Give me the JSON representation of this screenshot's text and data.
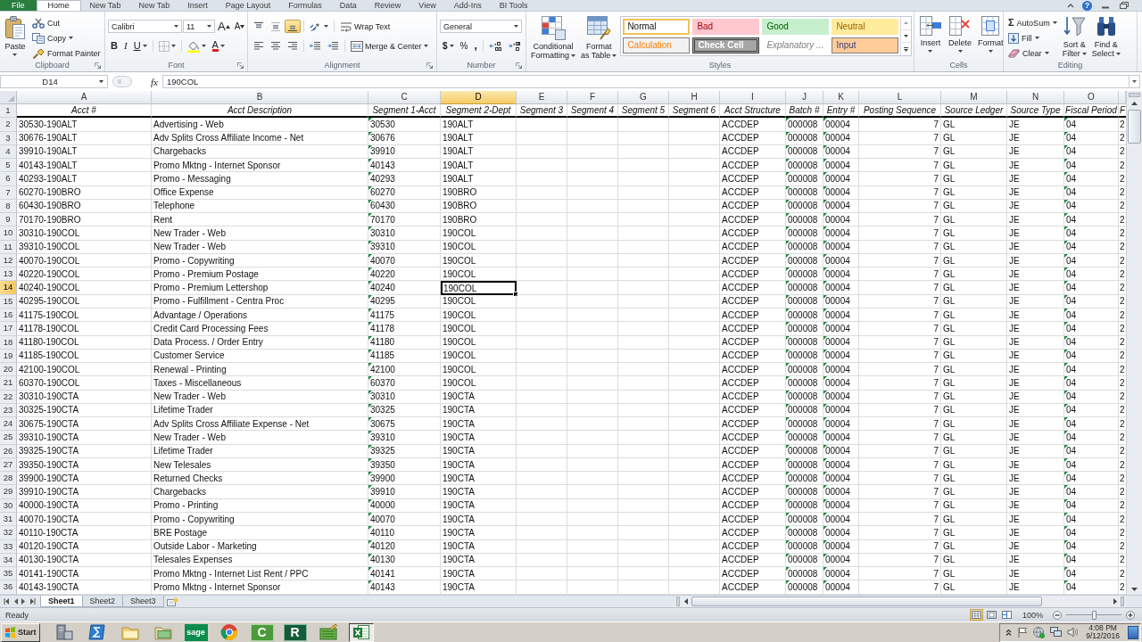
{
  "ribbon": {
    "tabs": [
      {
        "label": "File",
        "kind": "file",
        "selected": false
      },
      {
        "label": "Home",
        "kind": "tab",
        "selected": true
      },
      {
        "label": "New Tab",
        "kind": "tab",
        "selected": false
      },
      {
        "label": "New Tab",
        "kind": "tab",
        "selected": false
      },
      {
        "label": "Insert",
        "kind": "tab",
        "selected": false
      },
      {
        "label": "Page Layout",
        "kind": "tab",
        "selected": false
      },
      {
        "label": "Formulas",
        "kind": "tab",
        "selected": false
      },
      {
        "label": "Data",
        "kind": "tab",
        "selected": false
      },
      {
        "label": "Review",
        "kind": "tab",
        "selected": false
      },
      {
        "label": "View",
        "kind": "tab",
        "selected": false
      },
      {
        "label": "Add-Ins",
        "kind": "tab",
        "selected": false
      },
      {
        "label": "BI Tools",
        "kind": "tab",
        "selected": false
      }
    ],
    "help": "?",
    "groups": [
      {
        "label": "Clipboard",
        "launcher": true,
        "blocks": [
          {
            "kind": "large",
            "lines": [
              "Paste"
            ],
            "menu": true
          },
          {
            "kind": "stack",
            "items": [
              {
                "label": "Cut",
                "menu": false
              },
              {
                "label": "Copy",
                "menu": true
              },
              {
                "label": "Format Painter",
                "menu": false
              }
            ]
          }
        ]
      },
      {
        "label": "Font",
        "launcher": true,
        "blocks": [
          {
            "kind": "rows",
            "rows": [
              {
                "items": [
                  {
                    "kind": "combo",
                    "value": "Calibri"
                  },
                  {
                    "kind": "combo",
                    "value": "11"
                  },
                  {
                    "kind": "button",
                    "glyph": "A",
                    "menu": false,
                    "selected": false
                  },
                  {
                    "kind": "button",
                    "glyph": "A",
                    "menu": false,
                    "selected": false
                  }
                ]
              },
              {
                "items": [
                  {
                    "kind": "button",
                    "glyph": "B",
                    "menu": false,
                    "selected": false
                  },
                  {
                    "kind": "button",
                    "glyph": "I",
                    "menu": false,
                    "selected": false
                  },
                  {
                    "kind": "button",
                    "glyph": "U",
                    "menu": true,
                    "selected": false
                  },
                  {
                    "kind": "separator"
                  },
                  {
                    "kind": "button",
                    "menu": true,
                    "selected": false
                  },
                  {
                    "kind": "separator"
                  },
                  {
                    "kind": "button",
                    "menu": true,
                    "selected": false
                  },
                  {
                    "kind": "button",
                    "glyph": "A",
                    "menu": true,
                    "selected": false
                  }
                ]
              }
            ]
          }
        ]
      },
      {
        "label": "Alignment",
        "launcher": true,
        "blocks": [
          {
            "kind": "rows",
            "rows": [
              {
                "items": [
                  {
                    "kind": "button",
                    "menu": false,
                    "selected": false
                  },
                  {
                    "kind": "button",
                    "menu": false,
                    "selected": false
                  },
                  {
                    "kind": "button",
                    "menu": false,
                    "selected": true
                  },
                  {
                    "kind": "separator"
                  },
                  {
                    "kind": "button",
                    "menu": true,
                    "selected": false
                  },
                  {
                    "kind": "separator"
                  },
                  {
                    "kind": "button",
                    "label": "Wrap Text",
                    "menu": false,
                    "selected": false
                  }
                ]
              },
              {
                "items": [
                  {
                    "kind": "button",
                    "menu": false,
                    "selected": false
                  },
                  {
                    "kind": "button",
                    "menu": false,
                    "selected": false
                  },
                  {
                    "kind": "button",
                    "menu": false,
                    "selected": false
                  },
                  {
                    "kind": "separator"
                  },
                  {
                    "kind": "button",
                    "menu": false,
                    "selected": false
                  },
                  {
                    "kind": "button",
                    "menu": false,
                    "selected": false
                  },
                  {
                    "kind": "separator"
                  },
                  {
                    "kind": "button",
                    "label": "Merge & Center",
                    "menu": true,
                    "selected": false
                  }
                ]
              }
            ]
          }
        ]
      },
      {
        "label": "Number",
        "launcher": true,
        "blocks": [
          {
            "kind": "rows",
            "rows": [
              {
                "items": [
                  {
                    "kind": "combo",
                    "value": "General"
                  }
                ]
              },
              {
                "items": [
                  {
                    "kind": "button",
                    "glyph": "$",
                    "menu": true,
                    "selected": false
                  },
                  {
                    "kind": "button",
                    "glyph": "%",
                    "menu": false,
                    "selected": false
                  },
                  {
                    "kind": "button",
                    "glyph": ",",
                    "menu": false,
                    "selected": false
                  },
                  {
                    "kind": "separator"
                  },
                  {
                    "kind": "button",
                    "menu": false,
                    "selected": false
                  },
                  {
                    "kind": "button",
                    "menu": false,
                    "selected": false
                  }
                ]
              }
            ]
          }
        ]
      },
      {
        "label": "Styles",
        "launcher": false,
        "blocks": [
          {
            "kind": "large",
            "lines": [
              "Conditional",
              "Formatting"
            ],
            "menu": true
          },
          {
            "kind": "large",
            "lines": [
              "Format",
              "as Table"
            ],
            "menu": true
          },
          {
            "kind": "gallery",
            "items": [
              {
                "label": "Normal",
                "kind": "normal",
                "selected": true
              },
              {
                "label": "Bad",
                "kind": "bad",
                "selected": false
              },
              {
                "label": "Good",
                "kind": "good",
                "selected": false
              },
              {
                "label": "Neutral",
                "kind": "neutral",
                "selected": false
              },
              {
                "label": "Calculation",
                "kind": "calculation",
                "selected": false
              },
              {
                "label": "Check Cell",
                "kind": "check",
                "selected": false
              },
              {
                "label": "Explanatory ...",
                "kind": "explanatory",
                "selected": false
              },
              {
                "label": "Input",
                "kind": "input",
                "selected": false
              }
            ]
          }
        ]
      },
      {
        "label": "Cells",
        "launcher": false,
        "blocks": [
          {
            "kind": "large",
            "lines": [
              "Insert"
            ],
            "menu": true
          },
          {
            "kind": "large",
            "lines": [
              "Delete"
            ],
            "menu": true
          },
          {
            "kind": "large",
            "lines": [
              "Format"
            ],
            "menu": true
          }
        ]
      },
      {
        "label": "Editing",
        "launcher": false,
        "blocks": [
          {
            "kind": "stack",
            "items": [
              {
                "glyph": "Σ",
                "label": "AutoSum",
                "menu": true
              },
              {
                "label": "Fill",
                "menu": true
              },
              {
                "label": "Clear",
                "menu": true
              }
            ]
          },
          {
            "kind": "large",
            "lines": [
              "Sort &",
              "Filter"
            ],
            "menu": true
          },
          {
            "kind": "large",
            "lines": [
              "Find &",
              "Select"
            ],
            "menu": true
          }
        ]
      }
    ]
  },
  "formula_bar": {
    "name_box": "D14",
    "function_button": "fx",
    "formula": "190COL"
  },
  "sheet": {
    "columns": [
      {
        "letter": "A",
        "kind": "text",
        "flagged": false,
        "selected": false
      },
      {
        "letter": "B",
        "kind": "text",
        "flagged": false,
        "selected": false
      },
      {
        "letter": "C",
        "kind": "text",
        "flagged": true,
        "selected": false
      },
      {
        "letter": "D",
        "kind": "text",
        "flagged": false,
        "selected": true
      },
      {
        "letter": "E",
        "kind": "text",
        "flagged": false,
        "selected": false
      },
      {
        "letter": "F",
        "kind": "text",
        "flagged": false,
        "selected": false
      },
      {
        "letter": "G",
        "kind": "text",
        "flagged": false,
        "selected": false
      },
      {
        "letter": "H",
        "kind": "text",
        "flagged": false,
        "selected": false
      },
      {
        "letter": "I",
        "kind": "text",
        "flagged": false,
        "selected": false
      },
      {
        "letter": "J",
        "kind": "text",
        "flagged": true,
        "selected": false
      },
      {
        "letter": "K",
        "kind": "text",
        "flagged": true,
        "selected": false
      },
      {
        "letter": "L",
        "kind": "number",
        "flagged": false,
        "selected": false
      },
      {
        "letter": "M",
        "kind": "text",
        "flagged": false,
        "selected": false
      },
      {
        "letter": "N",
        "kind": "text",
        "flagged": false,
        "selected": false
      },
      {
        "letter": "O",
        "kind": "text",
        "flagged": true,
        "selected": false
      },
      {
        "kind": "text",
        "flagged": false,
        "selected": false
      }
    ],
    "rows": [
      {
        "number": "1",
        "kind": "header",
        "selected": false,
        "cells": [
          "Acct #",
          "Acct Description",
          "Segment 1-Acct",
          "Segment 2-Dept",
          "Segment 3",
          "Segment 4",
          "Segment 5",
          "Segment 6",
          "Acct Structure",
          "Batch #",
          "Entry #",
          "Posting Sequence",
          "Source Ledger",
          "Source Type",
          "Fiscal Period",
          "F"
        ]
      },
      {
        "number": "2",
        "kind": "data",
        "selected": false,
        "cells": [
          "30530-190ALT",
          "Advertising - Web",
          "30530",
          "190ALT",
          null,
          null,
          null,
          null,
          "ACCDEP",
          "000008",
          "00004",
          "7",
          "GL",
          "JE",
          "04",
          "2"
        ]
      },
      {
        "number": "3",
        "kind": "data",
        "selected": false,
        "cells": [
          "30676-190ALT",
          "Adv Splits Cross Affiliate Income - Net",
          "30676",
          "190ALT",
          null,
          null,
          null,
          null,
          "ACCDEP",
          "000008",
          "00004",
          "7",
          "GL",
          "JE",
          "04",
          "2"
        ]
      },
      {
        "number": "4",
        "kind": "data",
        "selected": false,
        "cells": [
          "39910-190ALT",
          "Chargebacks",
          "39910",
          "190ALT",
          null,
          null,
          null,
          null,
          "ACCDEP",
          "000008",
          "00004",
          "7",
          "GL",
          "JE",
          "04",
          "2"
        ]
      },
      {
        "number": "5",
        "kind": "data",
        "selected": false,
        "cells": [
          "40143-190ALT",
          "Promo Mktng - Internet Sponsor",
          "40143",
          "190ALT",
          null,
          null,
          null,
          null,
          "ACCDEP",
          "000008",
          "00004",
          "7",
          "GL",
          "JE",
          "04",
          "2"
        ]
      },
      {
        "number": "6",
        "kind": "data",
        "selected": false,
        "cells": [
          "40293-190ALT",
          "Promo - Messaging",
          "40293",
          "190ALT",
          null,
          null,
          null,
          null,
          "ACCDEP",
          "000008",
          "00004",
          "7",
          "GL",
          "JE",
          "04",
          "2"
        ]
      },
      {
        "number": "7",
        "kind": "data",
        "selected": false,
        "cells": [
          "60270-190BRO",
          "Office Expense",
          "60270",
          "190BRO",
          null,
          null,
          null,
          null,
          "ACCDEP",
          "000008",
          "00004",
          "7",
          "GL",
          "JE",
          "04",
          "2"
        ]
      },
      {
        "number": "8",
        "kind": "data",
        "selected": false,
        "cells": [
          "60430-190BRO",
          "Telephone",
          "60430",
          "190BRO",
          null,
          null,
          null,
          null,
          "ACCDEP",
          "000008",
          "00004",
          "7",
          "GL",
          "JE",
          "04",
          "2"
        ]
      },
      {
        "number": "9",
        "kind": "data",
        "selected": false,
        "cells": [
          "70170-190BRO",
          "Rent",
          "70170",
          "190BRO",
          null,
          null,
          null,
          null,
          "ACCDEP",
          "000008",
          "00004",
          "7",
          "GL",
          "JE",
          "04",
          "2"
        ]
      },
      {
        "number": "10",
        "kind": "data",
        "selected": false,
        "cells": [
          "30310-190COL",
          "New Trader - Web",
          "30310",
          "190COL",
          null,
          null,
          null,
          null,
          "ACCDEP",
          "000008",
          "00004",
          "7",
          "GL",
          "JE",
          "04",
          "2"
        ]
      },
      {
        "number": "11",
        "kind": "data",
        "selected": false,
        "cells": [
          "39310-190COL",
          "New Trader - Web",
          "39310",
          "190COL",
          null,
          null,
          null,
          null,
          "ACCDEP",
          "000008",
          "00004",
          "7",
          "GL",
          "JE",
          "04",
          "2"
        ]
      },
      {
        "number": "12",
        "kind": "data",
        "selected": false,
        "cells": [
          "40070-190COL",
          "Promo - Copywriting",
          "40070",
          "190COL",
          null,
          null,
          null,
          null,
          "ACCDEP",
          "000008",
          "00004",
          "7",
          "GL",
          "JE",
          "04",
          "2"
        ]
      },
      {
        "number": "13",
        "kind": "data",
        "selected": false,
        "cells": [
          "40220-190COL",
          "Promo - Premium Postage",
          "40220",
          "190COL",
          null,
          null,
          null,
          null,
          "ACCDEP",
          "000008",
          "00004",
          "7",
          "GL",
          "JE",
          "04",
          "2"
        ]
      },
      {
        "number": "14",
        "kind": "data",
        "selected": true,
        "cells": [
          "40240-190COL",
          "Promo - Premium Lettershop",
          "40240",
          "190COL",
          null,
          null,
          null,
          null,
          "ACCDEP",
          "000008",
          "00004",
          "7",
          "GL",
          "JE",
          "04",
          "2"
        ]
      },
      {
        "number": "15",
        "kind": "data",
        "selected": false,
        "cells": [
          "40295-190COL",
          "Promo - Fulfillment - Centra Proc",
          "40295",
          "190COL",
          null,
          null,
          null,
          null,
          "ACCDEP",
          "000008",
          "00004",
          "7",
          "GL",
          "JE",
          "04",
          "2"
        ]
      },
      {
        "number": "16",
        "kind": "data",
        "selected": false,
        "cells": [
          "41175-190COL",
          "Advantage / Operations",
          "41175",
          "190COL",
          null,
          null,
          null,
          null,
          "ACCDEP",
          "000008",
          "00004",
          "7",
          "GL",
          "JE",
          "04",
          "2"
        ]
      },
      {
        "number": "17",
        "kind": "data",
        "selected": false,
        "cells": [
          "41178-190COL",
          "Credit Card Processing Fees",
          "41178",
          "190COL",
          null,
          null,
          null,
          null,
          "ACCDEP",
          "000008",
          "00004",
          "7",
          "GL",
          "JE",
          "04",
          "2"
        ]
      },
      {
        "number": "18",
        "kind": "data",
        "selected": false,
        "cells": [
          "41180-190COL",
          "Data Process. / Order Entry",
          "41180",
          "190COL",
          null,
          null,
          null,
          null,
          "ACCDEP",
          "000008",
          "00004",
          "7",
          "GL",
          "JE",
          "04",
          "2"
        ]
      },
      {
        "number": "19",
        "kind": "data",
        "selected": false,
        "cells": [
          "41185-190COL",
          "Customer Service",
          "41185",
          "190COL",
          null,
          null,
          null,
          null,
          "ACCDEP",
          "000008",
          "00004",
          "7",
          "GL",
          "JE",
          "04",
          "2"
        ]
      },
      {
        "number": "20",
        "kind": "data",
        "selected": false,
        "cells": [
          "42100-190COL",
          "Renewal - Printing",
          "42100",
          "190COL",
          null,
          null,
          null,
          null,
          "ACCDEP",
          "000008",
          "00004",
          "7",
          "GL",
          "JE",
          "04",
          "2"
        ]
      },
      {
        "number": "21",
        "kind": "data",
        "selected": false,
        "cells": [
          "60370-190COL",
          "Taxes - Miscellaneous",
          "60370",
          "190COL",
          null,
          null,
          null,
          null,
          "ACCDEP",
          "000008",
          "00004",
          "7",
          "GL",
          "JE",
          "04",
          "2"
        ]
      },
      {
        "number": "22",
        "kind": "data",
        "selected": false,
        "cells": [
          "30310-190CTA",
          "New Trader - Web",
          "30310",
          "190CTA",
          null,
          null,
          null,
          null,
          "ACCDEP",
          "000008",
          "00004",
          "7",
          "GL",
          "JE",
          "04",
          "2"
        ]
      },
      {
        "number": "23",
        "kind": "data",
        "selected": false,
        "cells": [
          "30325-190CTA",
          "Lifetime Trader",
          "30325",
          "190CTA",
          null,
          null,
          null,
          null,
          "ACCDEP",
          "000008",
          "00004",
          "7",
          "GL",
          "JE",
          "04",
          "2"
        ]
      },
      {
        "number": "24",
        "kind": "data",
        "selected": false,
        "cells": [
          "30675-190CTA",
          "Adv Splits Cross Affiliate Expense - Net",
          "30675",
          "190CTA",
          null,
          null,
          null,
          null,
          "ACCDEP",
          "000008",
          "00004",
          "7",
          "GL",
          "JE",
          "04",
          "2"
        ]
      },
      {
        "number": "25",
        "kind": "data",
        "selected": false,
        "cells": [
          "39310-190CTA",
          "New Trader - Web",
          "39310",
          "190CTA",
          null,
          null,
          null,
          null,
          "ACCDEP",
          "000008",
          "00004",
          "7",
          "GL",
          "JE",
          "04",
          "2"
        ]
      },
      {
        "number": "26",
        "kind": "data",
        "selected": false,
        "cells": [
          "39325-190CTA",
          "Lifetime Trader",
          "39325",
          "190CTA",
          null,
          null,
          null,
          null,
          "ACCDEP",
          "000008",
          "00004",
          "7",
          "GL",
          "JE",
          "04",
          "2"
        ]
      },
      {
        "number": "27",
        "kind": "data",
        "selected": false,
        "cells": [
          "39350-190CTA",
          "New Telesales",
          "39350",
          "190CTA",
          null,
          null,
          null,
          null,
          "ACCDEP",
          "000008",
          "00004",
          "7",
          "GL",
          "JE",
          "04",
          "2"
        ]
      },
      {
        "number": "28",
        "kind": "data",
        "selected": false,
        "cells": [
          "39900-190CTA",
          "Returned Checks",
          "39900",
          "190CTA",
          null,
          null,
          null,
          null,
          "ACCDEP",
          "000008",
          "00004",
          "7",
          "GL",
          "JE",
          "04",
          "2"
        ]
      },
      {
        "number": "29",
        "kind": "data",
        "selected": false,
        "cells": [
          "39910-190CTA",
          "Chargebacks",
          "39910",
          "190CTA",
          null,
          null,
          null,
          null,
          "ACCDEP",
          "000008",
          "00004",
          "7",
          "GL",
          "JE",
          "04",
          "2"
        ]
      },
      {
        "number": "30",
        "kind": "data",
        "selected": false,
        "cells": [
          "40000-190CTA",
          "Promo - Printing",
          "40000",
          "190CTA",
          null,
          null,
          null,
          null,
          "ACCDEP",
          "000008",
          "00004",
          "7",
          "GL",
          "JE",
          "04",
          "2"
        ]
      },
      {
        "number": "31",
        "kind": "data",
        "selected": false,
        "cells": [
          "40070-190CTA",
          "Promo - Copywriting",
          "40070",
          "190CTA",
          null,
          null,
          null,
          null,
          "ACCDEP",
          "000008",
          "00004",
          "7",
          "GL",
          "JE",
          "04",
          "2"
        ]
      },
      {
        "number": "32",
        "kind": "data",
        "selected": false,
        "cells": [
          "40110-190CTA",
          "BRE Postage",
          "40110",
          "190CTA",
          null,
          null,
          null,
          null,
          "ACCDEP",
          "000008",
          "00004",
          "7",
          "GL",
          "JE",
          "04",
          "2"
        ]
      },
      {
        "number": "33",
        "kind": "data",
        "selected": false,
        "cells": [
          "40120-190CTA",
          "Outside Labor - Marketing",
          "40120",
          "190CTA",
          null,
          null,
          null,
          null,
          "ACCDEP",
          "000008",
          "00004",
          "7",
          "GL",
          "JE",
          "04",
          "2"
        ]
      },
      {
        "number": "34",
        "kind": "data",
        "selected": false,
        "cells": [
          "40130-190CTA",
          "Telesales Expenses",
          "40130",
          "190CTA",
          null,
          null,
          null,
          null,
          "ACCDEP",
          "000008",
          "00004",
          "7",
          "GL",
          "JE",
          "04",
          "2"
        ]
      },
      {
        "number": "35",
        "kind": "data",
        "selected": false,
        "cells": [
          "40141-190CTA",
          "Promo Mktng - Internet List Rent / PPC",
          "40141",
          "190CTA",
          null,
          null,
          null,
          null,
          "ACCDEP",
          "000008",
          "00004",
          "7",
          "GL",
          "JE",
          "04",
          "2"
        ]
      },
      {
        "number": "36",
        "kind": "data",
        "selected": false,
        "cells": [
          "40143-190CTA",
          "Promo Mktng - Internet Sponsor",
          "40143",
          "190CTA",
          null,
          null,
          null,
          null,
          "ACCDEP",
          "000008",
          "00004",
          "7",
          "GL",
          "JE",
          "04",
          "2"
        ]
      }
    ]
  },
  "sheet_tabs": [
    {
      "label": "Sheet1",
      "selected": true
    },
    {
      "label": "Sheet2",
      "selected": false
    },
    {
      "label": "Sheet3",
      "selected": false
    }
  ],
  "status_bar": {
    "text": "Ready",
    "views": [
      {
        "selected": true
      },
      {
        "selected": false
      },
      {
        "selected": false
      }
    ],
    "zoom": "100%",
    "zoom_slider": {
      "level": 0.5
    }
  },
  "taskbar": {
    "start": "Start",
    "apps": [
      {
        "selected": false
      },
      {
        "selected": false
      },
      {
        "selected": false
      },
      {
        "selected": false
      },
      {
        "label": "sage",
        "selected": false
      },
      {
        "selected": false
      },
      {
        "label": "C",
        "selected": false
      },
      {
        "label": "R",
        "selected": false
      },
      {
        "selected": false
      },
      {
        "selected": true
      }
    ],
    "clock": {
      "time": "4:08 PM",
      "date": "9/12/2016"
    }
  }
}
